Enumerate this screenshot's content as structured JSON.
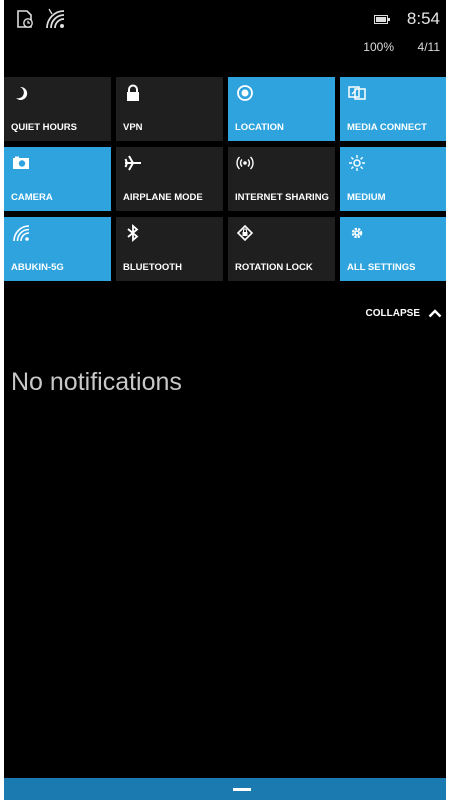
{
  "status_bar": {
    "icons": [
      "screen-timeout-icon",
      "wifi-signal-icon",
      "battery-icon"
    ],
    "time": "8:54",
    "battery": "100%",
    "date": "4/11"
  },
  "tiles": [
    {
      "label": "QUIET HOURS",
      "icon": "moon-icon",
      "on": false
    },
    {
      "label": "VPN",
      "icon": "lock-icon",
      "on": false
    },
    {
      "label": "LOCATION",
      "icon": "location-icon",
      "on": true
    },
    {
      "label": "MEDIA CONNECT",
      "icon": "media-connect-icon",
      "on": true
    },
    {
      "label": "CAMERA",
      "icon": "camera-icon",
      "on": true
    },
    {
      "label": "AIRPLANE MODE",
      "icon": "airplane-icon",
      "on": false
    },
    {
      "label": "INTERNET SHARING",
      "icon": "internet-sharing-icon",
      "on": false
    },
    {
      "label": "MEDIUM",
      "icon": "brightness-icon",
      "on": true
    },
    {
      "label": "ABUKIN-5G",
      "icon": "wifi-icon",
      "on": true
    },
    {
      "label": "BLUETOOTH",
      "icon": "bluetooth-icon",
      "on": false
    },
    {
      "label": "ROTATION LOCK",
      "icon": "rotation-lock-icon",
      "on": false
    },
    {
      "label": "ALL SETTINGS",
      "icon": "settings-gear-icon",
      "on": true
    }
  ],
  "collapse": {
    "label": "COLLAPSE",
    "icon": "chevron-up-icon"
  },
  "notifications": {
    "empty_text": "No notifications"
  },
  "colors": {
    "accent": "#2ea3de",
    "tile_off": "#1f1f1f",
    "background": "#000000",
    "bottom_bar": "#1b7bb0"
  }
}
